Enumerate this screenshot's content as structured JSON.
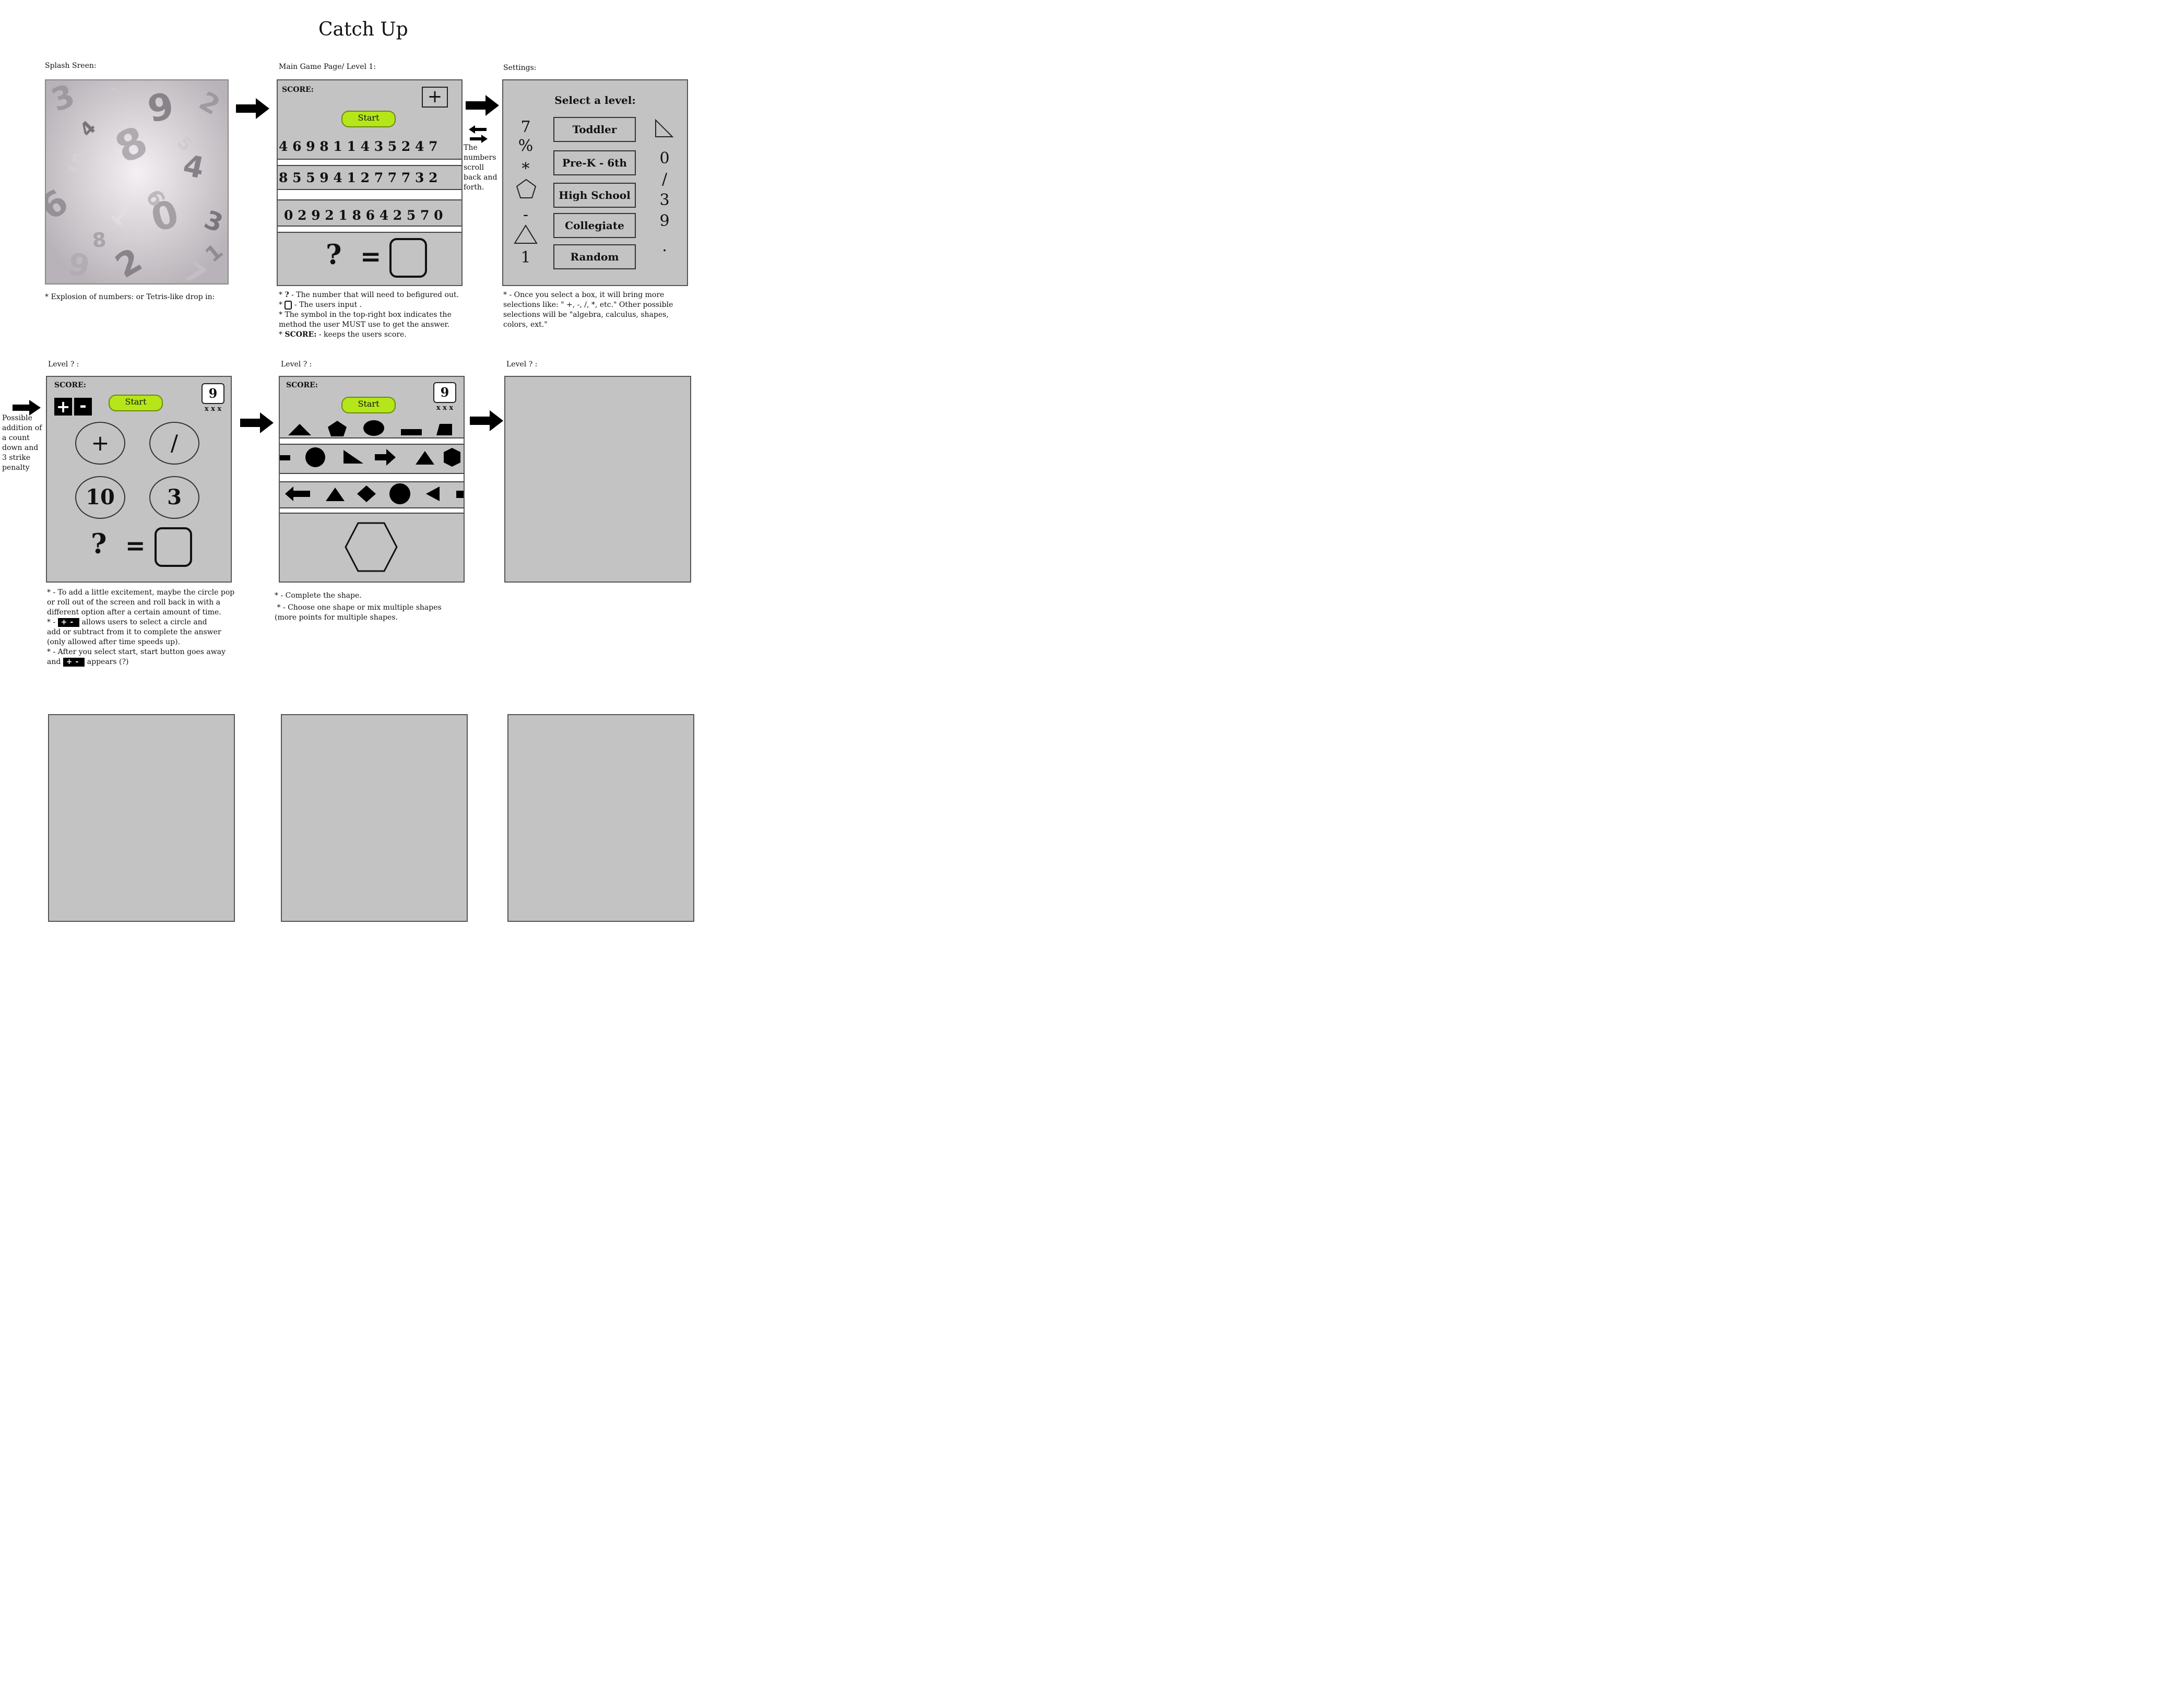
{
  "title": "Catch Up",
  "panels": {
    "splash": {
      "caption": "Splash Sreen:",
      "note": "* Explosion of numbers: or  Tetris-like drop in:"
    },
    "main": {
      "caption": "Main Game Page/ Level 1:",
      "score_label": "SCORE:",
      "plus_symbol": "+",
      "start_label": "Start",
      "rows": [
        "4 6 9 8 1 1 4 3 5 2 4 7",
        "8 5 5 9 4 1 2 7 7 7 3 2",
        "0 2 9 2 1 8 6 4 2 5 7 0"
      ],
      "question": "?",
      "equals": "=",
      "notes": {
        "n1_prefix": "* ",
        "n1_q": "?",
        "n1_text": " - The number that will need to befigured out.",
        "n2_prefix": "* ",
        "n2_text": " - The users input .",
        "n3": "*  The symbol in the top-right box indicates the",
        "n3b": "method the user MUST use to get the answer.",
        "n4_prefix": "* ",
        "n4_bold": "SCORE:",
        "n4_text": " - keeps the users score."
      },
      "side_note": [
        "The",
        "numbers",
        "scroll",
        "back and",
        "forth."
      ]
    },
    "settings": {
      "caption": "Settings:",
      "heading": "Select a level:",
      "levels": [
        "Toddler",
        "Pre-K  -  6th",
        "High School",
        "Collegiate",
        "Random"
      ],
      "left_symbols": [
        "7",
        "%",
        "*",
        "-",
        "1"
      ],
      "right_symbols": [
        "0",
        "/",
        "3",
        "9",
        "."
      ],
      "notes": [
        "* - Once you select a box, it will bring more",
        "selections like: \" +, -, /, *, etc.\" Other possible",
        "selections will be \"algebra, calculus, shapes,",
        "colors, ext.\""
      ]
    },
    "level_a": {
      "caption": "Level ? :",
      "score_label": "SCORE:",
      "plus": "+",
      "minus": "-",
      "start_label": "Start",
      "counter": "9",
      "strikes": "x x x",
      "circles": [
        "+",
        "/",
        "10",
        "3"
      ],
      "question": "?",
      "equals": "=",
      "side_note": [
        "Possible",
        "addition of",
        "a count",
        "down and",
        "3 strike",
        "penalty"
      ],
      "notes": {
        "l1": "* - To add a little excitement, maybe the circle pop",
        "l2": "or roll out of the screen and roll back in with a",
        "l3": "different option after a certain amount of time.",
        "l4_prefix": "* - ",
        "l4_text": "  allows users to select a circle and",
        "l5": "add or subtract from it to complete the answer",
        "l6": "(only allowed after time speeds up).",
        "l7": "* - After you select start, start button goes away",
        "l8_prefix": "and ",
        "l8_text": " appears (?)"
      }
    },
    "level_b": {
      "caption": "Level ? :",
      "score_label": "SCORE:",
      "start_label": "Start",
      "counter": "9",
      "strikes": "x x x",
      "notes": [
        "* - Complete the shape.",
        " * - Choose one shape or mix multiple shapes",
        "(more points for multiple shapes."
      ]
    },
    "level_c": {
      "caption": "Level ? :"
    }
  },
  "icons": [
    "right-arrow-icon",
    "left-right-arrows-icon",
    "triangle-icon",
    "pentagon-icon",
    "ellipse-icon",
    "rectangle-icon",
    "trapezoid-icon",
    "circle-icon",
    "right-triangle-icon",
    "arrow-icon",
    "hexagon-icon",
    "diamond-icon"
  ],
  "colors": {
    "frame": "#c3c3c3",
    "start_button": "#b4e619",
    "background": "#ffffff"
  }
}
